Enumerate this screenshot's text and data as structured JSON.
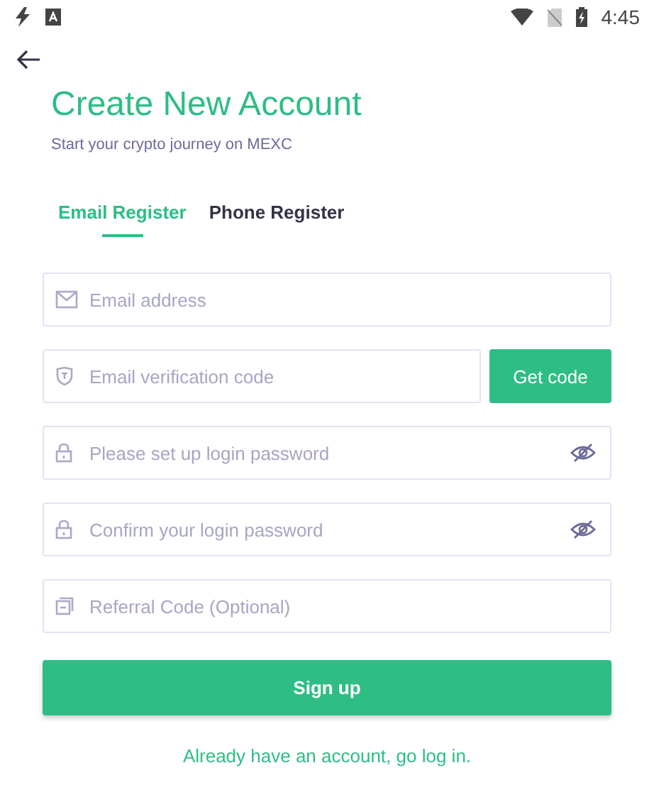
{
  "status_bar": {
    "time": "4:45"
  },
  "title": "Create New Account",
  "subtitle": "Start your crypto journey on MEXC",
  "tabs": [
    {
      "label": "Email Register",
      "selected": true
    },
    {
      "label": "Phone Register",
      "selected": false
    }
  ],
  "fields": [
    {
      "kind": "email",
      "placeholder": "Email address"
    },
    {
      "kind": "code",
      "placeholder": "Email verification code",
      "button": "Get code"
    },
    {
      "kind": "password",
      "placeholder": "Please set up login password"
    },
    {
      "kind": "password",
      "placeholder": "Confirm your login password"
    },
    {
      "kind": "referral",
      "placeholder": "Referral Code (Optional)"
    }
  ],
  "submit": "Sign up",
  "login_link": "Already have an account, go log in."
}
